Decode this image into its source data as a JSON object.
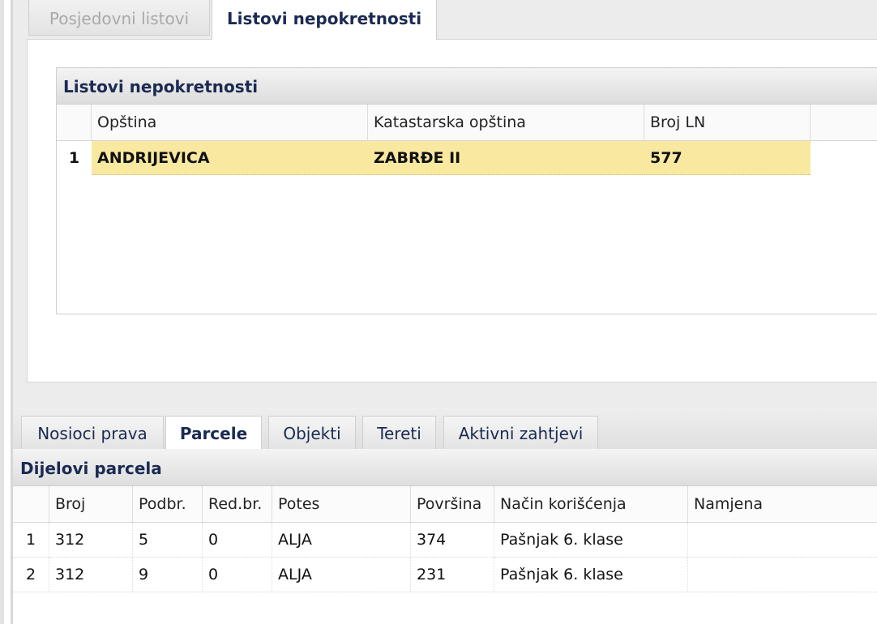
{
  "upper_tabs": [
    {
      "label": "Posjedovni listovi",
      "active": false
    },
    {
      "label": "Listovi nepokretnosti",
      "active": true
    }
  ],
  "ln_grid": {
    "title": "Listovi nepokretnosti",
    "columns": [
      "Opština",
      "Katastarska opština",
      "Broj LN"
    ],
    "rows": [
      {
        "num": "1",
        "opstina": "ANDRIJEVICA",
        "ko": "ZABRĐE II",
        "broj_ln": "577",
        "selected": true
      }
    ]
  },
  "lower_tabs": [
    {
      "label": "Nosioci prava",
      "active": false
    },
    {
      "label": "Parcele",
      "active": true
    },
    {
      "label": "Objekti",
      "active": false
    },
    {
      "label": "Tereti",
      "active": false
    },
    {
      "label": "Aktivni zahtjevi",
      "active": false
    }
  ],
  "parcels": {
    "title": "Dijelovi parcela",
    "columns": [
      "Broj",
      "Podbr.",
      "Red.br.",
      "Potes",
      "Površina",
      "Način korišćenja",
      "Namjena"
    ],
    "rows": [
      {
        "num": "1",
        "broj": "312",
        "podbr": "5",
        "redbr": "0",
        "potes": "ALJA",
        "povrsina": "374",
        "nacin": "Pašnjak 6. klase",
        "namjena": ""
      },
      {
        "num": "2",
        "broj": "312",
        "podbr": "9",
        "redbr": "0",
        "potes": "ALJA",
        "povrsina": "231",
        "nacin": "Pašnjak 6. klase",
        "namjena": ""
      }
    ]
  },
  "colors": {
    "selected_row": "#f9e9a0",
    "title_text": "#1a2a52"
  }
}
